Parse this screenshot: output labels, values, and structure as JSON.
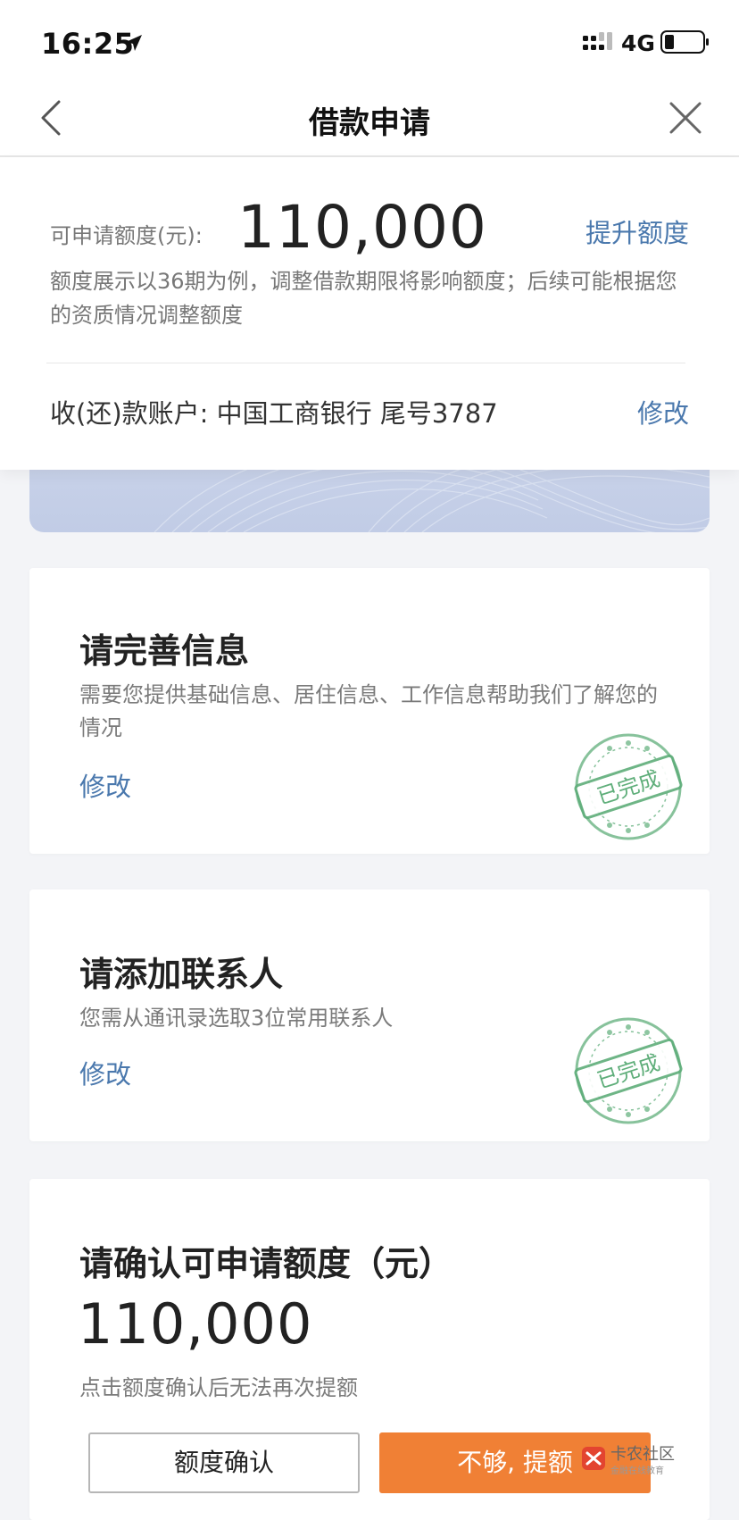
{
  "status_bar": {
    "time": "16:25",
    "network": "4G",
    "icons": [
      "location-arrow-icon",
      "signal-icon",
      "battery-icon"
    ]
  },
  "nav": {
    "title": "借款申请",
    "icons": [
      "chevron-left-icon",
      "close-icon"
    ]
  },
  "limit": {
    "label": "可申请额度(元):",
    "value": "110,000",
    "raise_link": "提升额度",
    "note": "额度展示以36期为例，调整借款期限将影响额度；后续可能根据您的资质情况调整额度"
  },
  "account": {
    "label": "收(还)款账户: 中国工商银行 尾号3787",
    "edit_link": "修改"
  },
  "info_card": {
    "title": "请完善信息",
    "desc": "需要您提供基础信息、居住信息、工作信息帮助我们了解您的情况",
    "edit_link": "修改",
    "stamp": "已完成"
  },
  "contacts_card": {
    "title": "请添加联系人",
    "desc": "您需从通讯录选取3位常用联系人",
    "edit_link": "修改",
    "stamp": "已完成"
  },
  "confirm_card": {
    "title": "请确认可申请额度（元）",
    "value": "110,000",
    "note": "点击额度确认后无法再次提额",
    "confirm_button": "额度确认",
    "raise_button": "不够, 提额"
  },
  "watermark": {
    "name": "卡农社区",
    "sub": "金融在线教育"
  },
  "colors": {
    "link": "#4a78ad",
    "primary_button": "#f08035",
    "stamp": "#5fae7a",
    "card_blue": "#c6d0e8"
  }
}
